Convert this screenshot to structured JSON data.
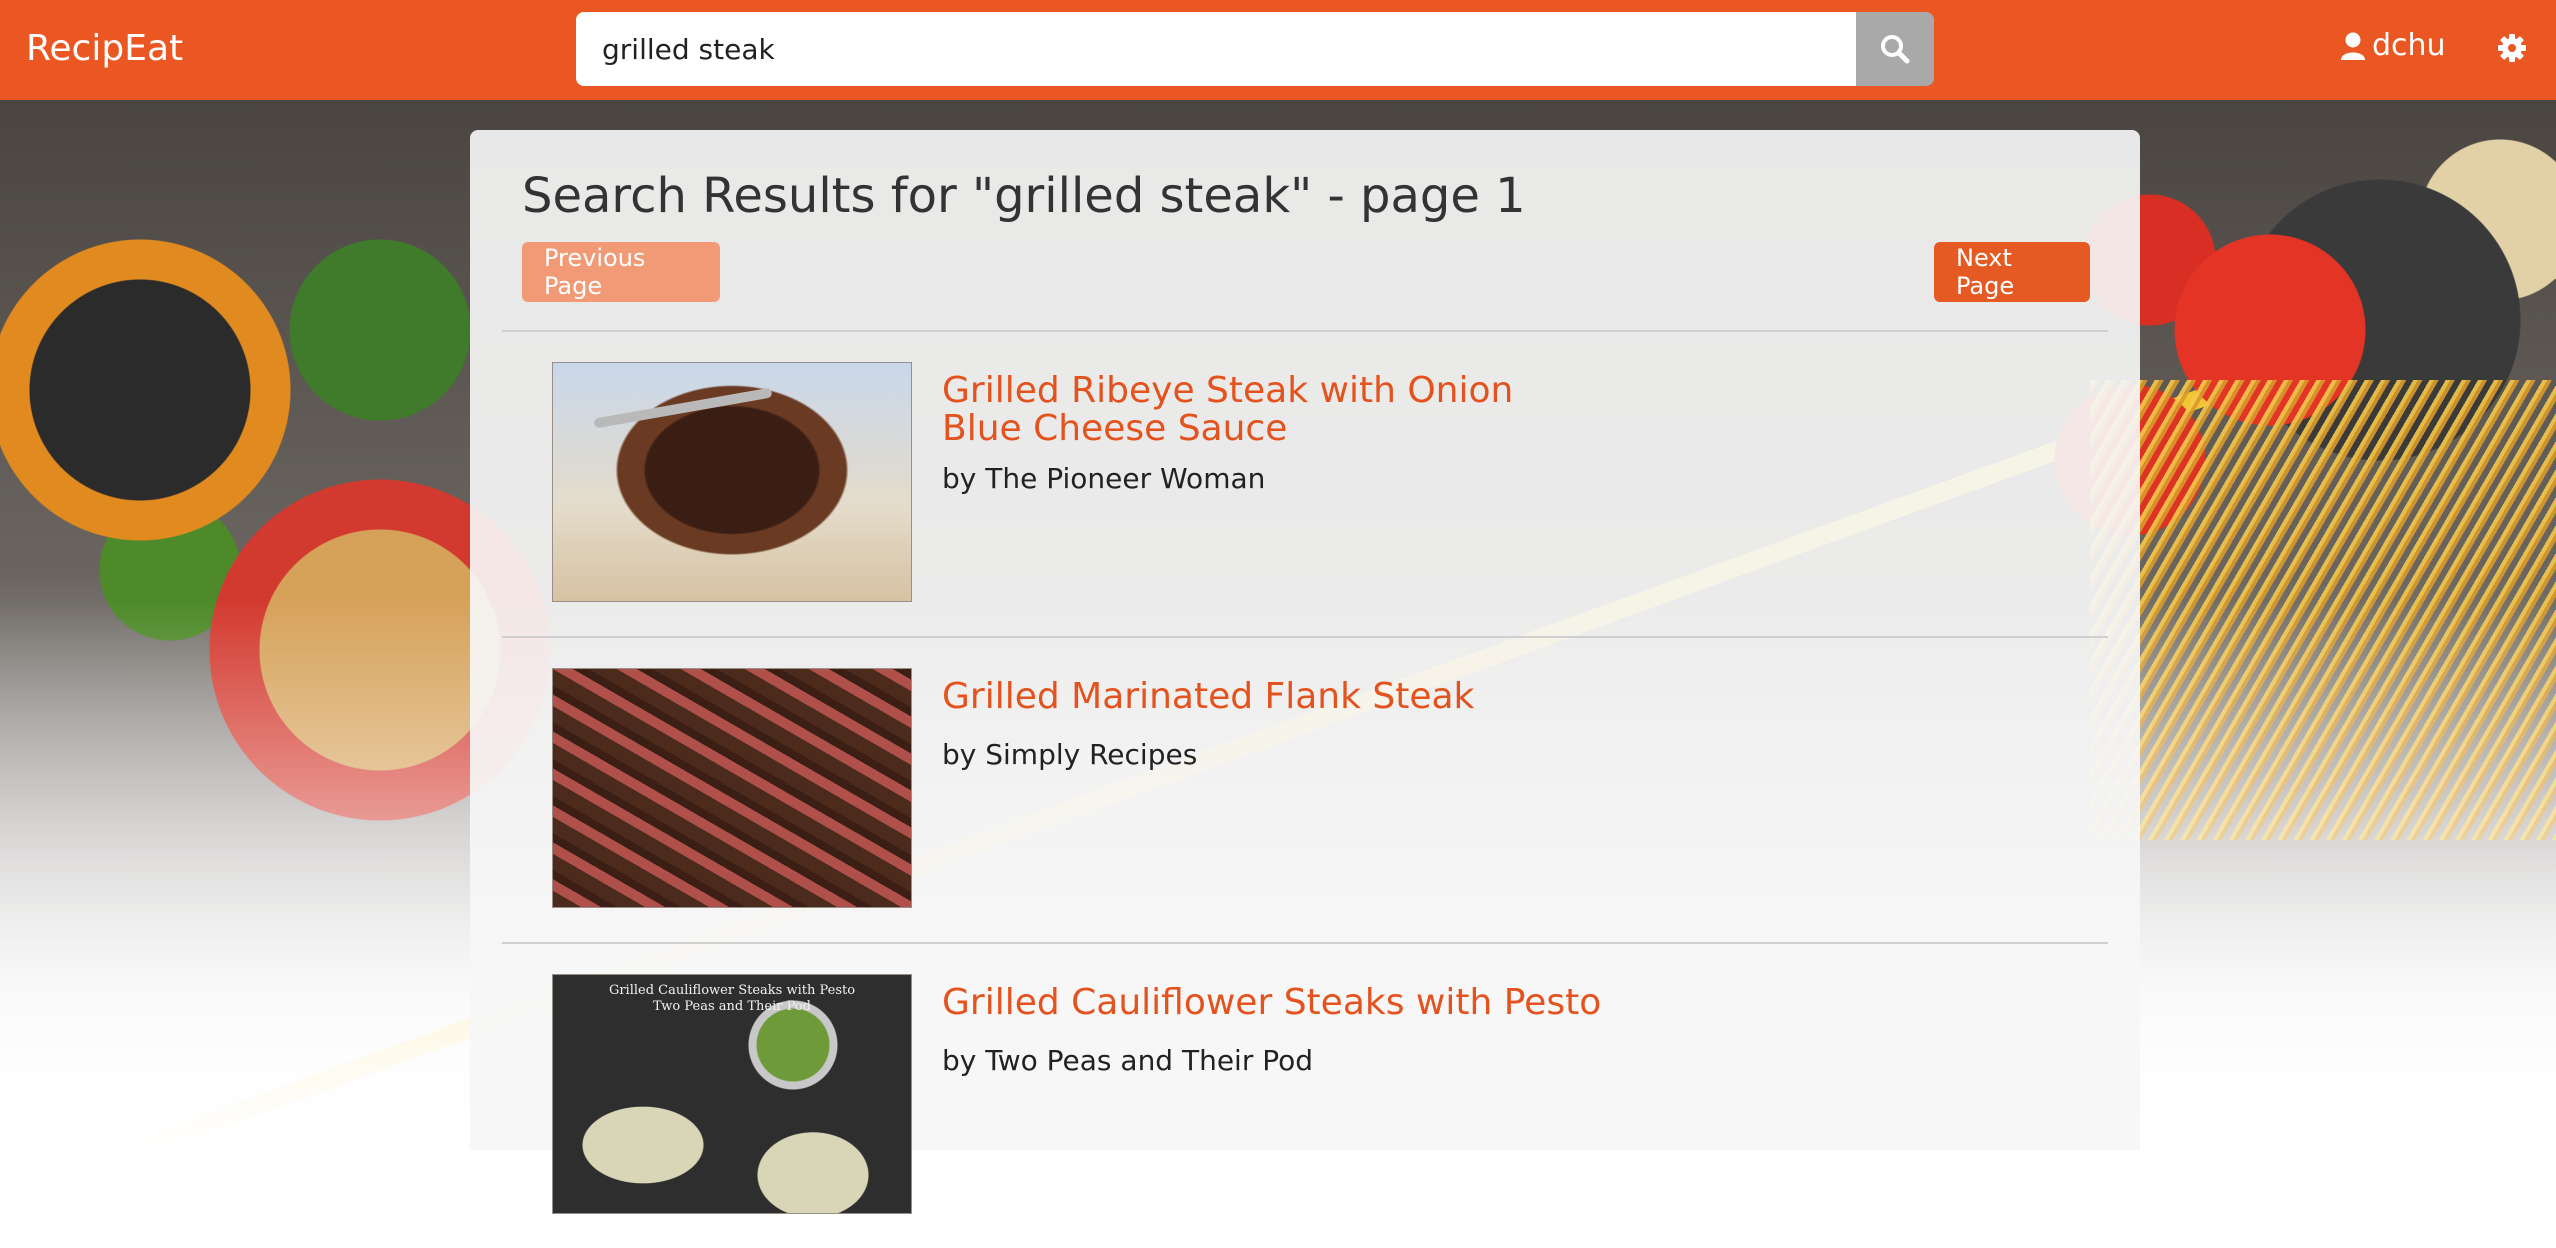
{
  "navbar": {
    "brand": "RecipEat",
    "search": {
      "value": "grilled steak",
      "placeholder": ""
    },
    "username": "dchu",
    "accent_color": "#ea5722"
  },
  "results_page": {
    "title": "Search Results for \"grilled steak\" - page 1",
    "previous_label": "Previous Page",
    "next_label": "Next Page",
    "items": [
      {
        "title": "Grilled Ribeye Steak with Onion Blue Cheese Sauce",
        "author": "by The Pioneer Woman"
      },
      {
        "title": "Grilled Marinated Flank Steak",
        "author": "by Simply Recipes"
      },
      {
        "title": "Grilled Cauliflower Steaks with Pesto",
        "author": "by Two Peas and Their Pod",
        "image_caption": "Grilled Cauliflower Steaks with Pesto\nTwo Peas and Their Pod"
      }
    ]
  },
  "icons": {
    "search": "search-icon",
    "user": "user-icon",
    "settings": "gear-icon"
  }
}
